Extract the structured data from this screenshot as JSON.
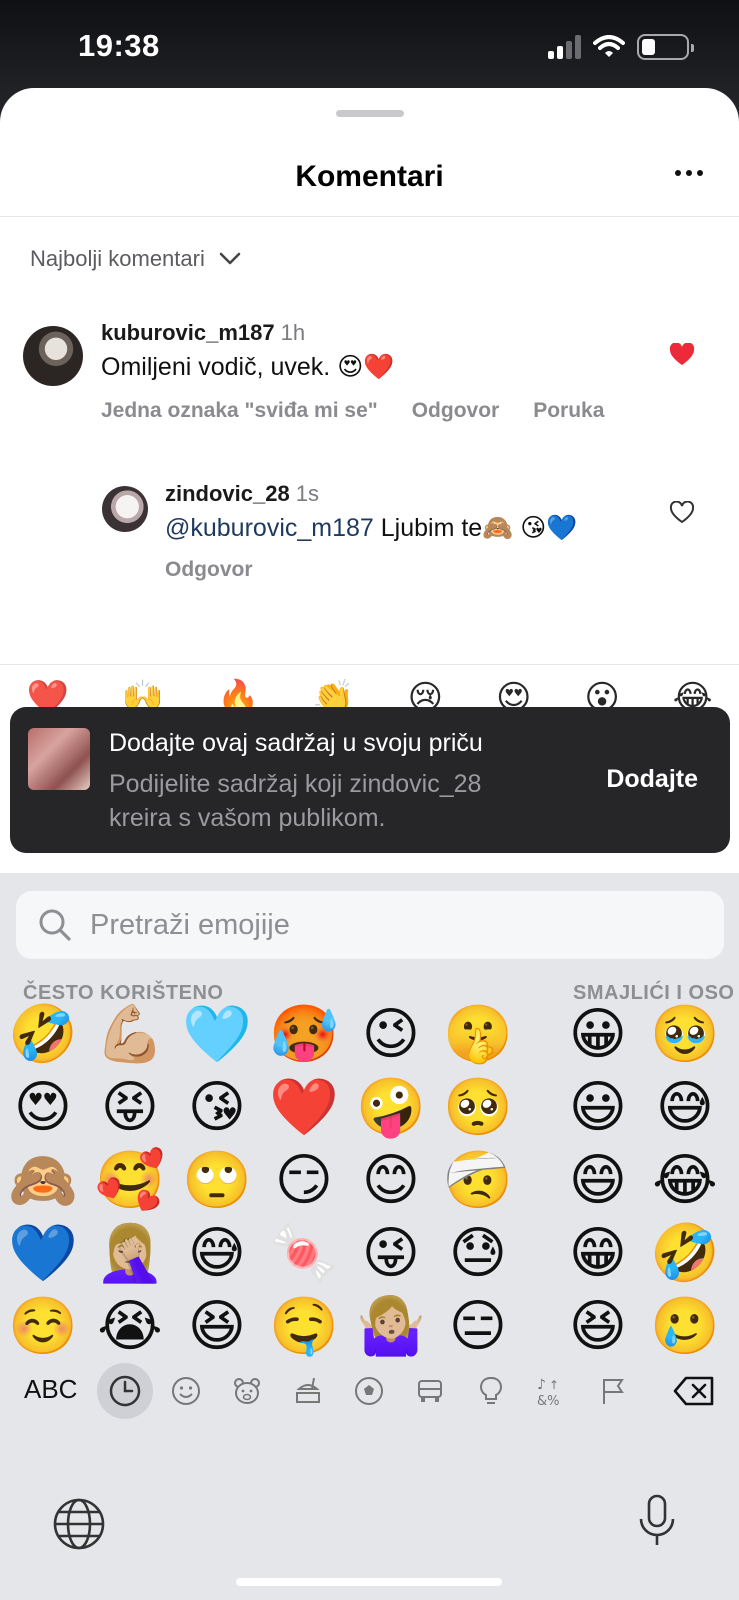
{
  "status_bar": {
    "time": "19:38"
  },
  "sheet": {
    "title": "Komentari",
    "sort_label": "Najbolji komentari"
  },
  "comments": [
    {
      "username": "kuburovic_m187",
      "time": "1h",
      "text": "Omiljeni vodič, uvek. 😍❤️",
      "liked": true,
      "actions": [
        "Jedna oznaka \"sviđa mi se\"",
        "Odgovor",
        "Poruka"
      ]
    },
    {
      "username": "zindovic_28",
      "time": "1s",
      "mention": "@kuburovic_m187",
      "text": " Ljubim te🙈 😘💙",
      "liked": false,
      "actions": [
        "Odgovor"
      ]
    }
  ],
  "reaction_peek": [
    "❤️",
    "🙌",
    "🔥",
    "👏",
    "😢",
    "😍",
    "😮",
    "😂"
  ],
  "toast": {
    "title": "Dodajte ovaj sadržaj u svoju priču",
    "subtitle": "Podijelite sadržaj koji zindovic_28 kreira s vašom publikom.",
    "action": "Dodajte"
  },
  "keyboard": {
    "search_placeholder": "Pretraži emojije",
    "section_frequent": "ČESTO KORIŠTENO",
    "section_smileys": "SMAJLIĆI I OSO",
    "frequent_rows": [
      [
        "🤣",
        "💪🏼",
        "🩵",
        "🥵",
        "😉",
        "🤫"
      ],
      [
        "😍",
        "😝",
        "😘",
        "❤️",
        "🤪",
        "🥺"
      ],
      [
        "🙈",
        "🥰",
        "🙄",
        "😏",
        "😊",
        "🤕"
      ],
      [
        "💙",
        "🤦🏼‍♀️",
        "😅",
        "🍬",
        "😜",
        "😓"
      ],
      [
        "☺️",
        "😭",
        "😆",
        "🤤",
        "🤷🏼‍♀️",
        "😑"
      ]
    ],
    "smiley_rows": [
      [
        "😀",
        "🥹"
      ],
      [
        "😃",
        "😅"
      ],
      [
        "😄",
        "😂"
      ],
      [
        "😁",
        "🤣"
      ],
      [
        "😆",
        "🥲"
      ]
    ],
    "abc_label": "ABC",
    "categories": [
      "recent-icon",
      "smiley-icon",
      "animal-icon",
      "food-icon",
      "ball-icon",
      "travel-icon",
      "lightbulb-icon",
      "symbols-icon",
      "flag-icon"
    ]
  }
}
